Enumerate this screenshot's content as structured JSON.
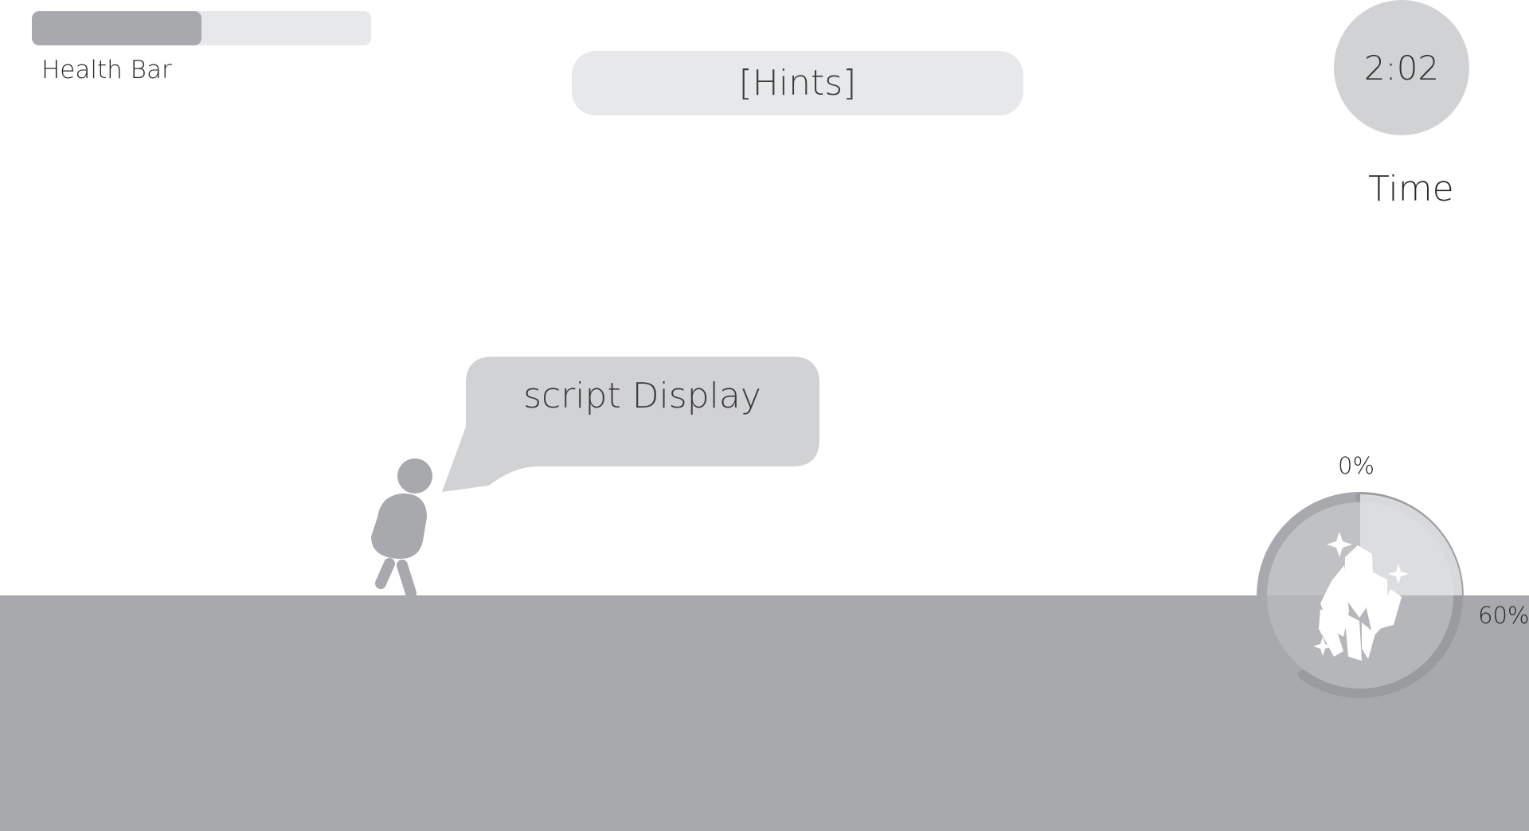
{
  "hud": {
    "health": {
      "label": "Health Bar",
      "fraction": 0.5
    },
    "hints": {
      "label": "[Hints]"
    },
    "timer": {
      "value": "2:02",
      "label": "Time"
    }
  },
  "dialogue": {
    "text": "script Display"
  },
  "crystal_progress": {
    "start_label": "0%",
    "current_label": "60%",
    "fraction": 0.6,
    "icon": "crystal-cluster-icon"
  },
  "colors": {
    "ground": "#a8a9ac",
    "panel": "#e7e8e9",
    "bubble": "#d1d2d4",
    "character": "#a8a9ac"
  }
}
